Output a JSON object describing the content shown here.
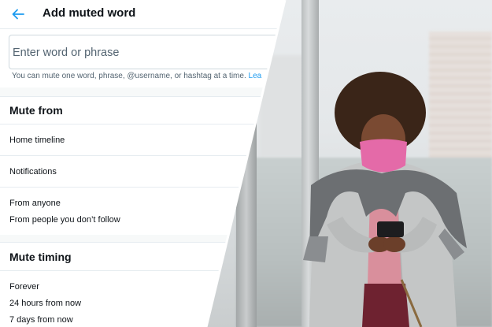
{
  "header": {
    "title": "Add muted word",
    "back_icon": "arrow-left-icon",
    "accent_color": "#1d9bf0"
  },
  "input": {
    "placeholder": "Enter word or phrase",
    "value": ""
  },
  "hint": {
    "text": "You can mute one word, phrase, @username, or hashtag at a time.",
    "link": "Lea"
  },
  "mute_from": {
    "title": "Mute from",
    "options": [
      "Home timeline",
      "Notifications"
    ],
    "audience": [
      "From anyone",
      "From people you don’t follow"
    ]
  },
  "mute_timing": {
    "title": "Mute timing",
    "options": [
      "Forever",
      "24 hours from now",
      "7 days from now"
    ]
  }
}
